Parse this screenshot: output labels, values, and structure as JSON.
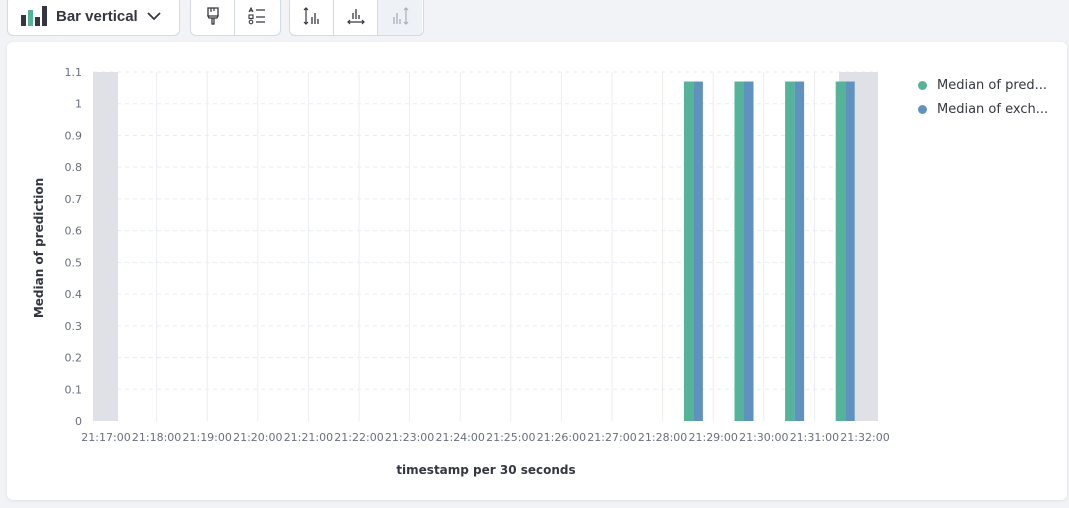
{
  "toolbar": {
    "chart_type_label": "Bar vertical",
    "chart_type_icon": "bar-chart-icon",
    "style_buttons": [
      {
        "name": "paintbrush-icon",
        "disabled": false
      },
      {
        "name": "list-settings-icon",
        "disabled": false
      }
    ],
    "axis_buttons": [
      {
        "name": "left-axis-icon",
        "disabled": false
      },
      {
        "name": "bottom-axis-icon",
        "disabled": false
      },
      {
        "name": "right-axis-icon",
        "disabled": true
      }
    ]
  },
  "colors": {
    "series_1": "#54b399",
    "series_2": "#6092c0",
    "text": "#343741",
    "axis_text": "#69707d",
    "grid": "#e9edf3",
    "out_of_range": "#e0e1e6"
  },
  "chart_data": {
    "type": "bar",
    "title": "",
    "xlabel": "timestamp per 30 seconds",
    "ylabel": "Median of prediction",
    "x_ticks": [
      "21:17:00",
      "21:18:00",
      "21:19:00",
      "21:20:00",
      "21:21:00",
      "21:22:00",
      "21:23:00",
      "21:24:00",
      "21:25:00",
      "21:26:00",
      "21:27:00",
      "21:28:00",
      "21:29:00",
      "21:30:00",
      "21:31:00",
      "21:32:00"
    ],
    "y_ticks": [
      "0",
      "0.1",
      "0.2",
      "0.3",
      "0.4",
      "0.5",
      "0.6",
      "0.7",
      "0.8",
      "0.9",
      "1",
      "1.1"
    ],
    "ylim": [
      0,
      1.1
    ],
    "grid": true,
    "legend_position": "top-right",
    "x": [
      "21:28:30",
      "21:29:30",
      "21:30:30",
      "21:31:30"
    ],
    "series": [
      {
        "name": "Median of pred...",
        "values": [
          1.07,
          1.07,
          1.07,
          1.07
        ]
      },
      {
        "name": "Median of exch...",
        "values": [
          1.07,
          1.07,
          1.07,
          1.07
        ]
      }
    ]
  }
}
